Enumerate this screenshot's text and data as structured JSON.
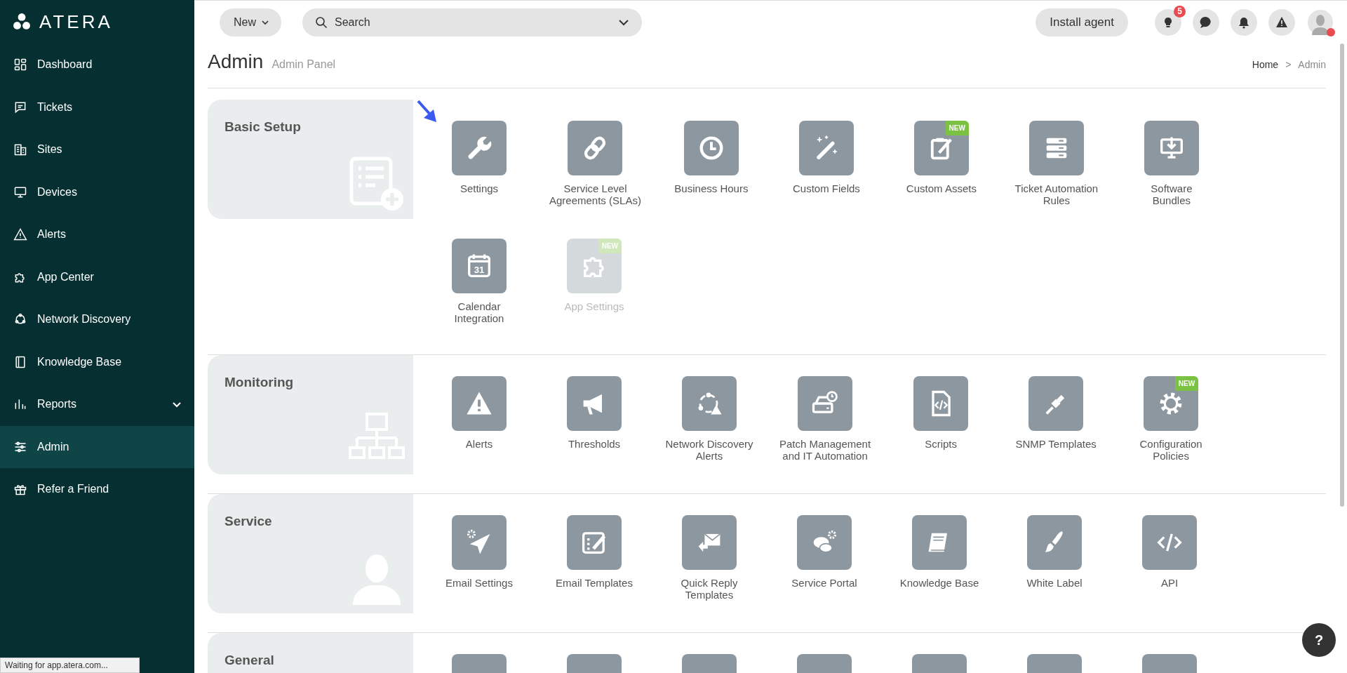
{
  "sidebar": {
    "logo": "ATERA",
    "items": [
      {
        "label": "Dashboard",
        "kind": "link",
        "selected": false
      },
      {
        "label": "Tickets",
        "kind": "link",
        "selected": false
      },
      {
        "label": "Sites",
        "kind": "link",
        "selected": false
      },
      {
        "label": "Devices",
        "kind": "link",
        "selected": false
      },
      {
        "label": "Alerts",
        "kind": "link",
        "selected": false
      },
      {
        "label": "App Center",
        "kind": "link",
        "selected": false
      },
      {
        "label": "Network Discovery",
        "kind": "link",
        "selected": false
      },
      {
        "label": "Knowledge Base",
        "kind": "link",
        "selected": false
      },
      {
        "label": "Reports",
        "kind": "group",
        "selected": false
      },
      {
        "label": "Admin",
        "kind": "link",
        "selected": true
      },
      {
        "label": "Refer a Friend",
        "kind": "link",
        "selected": false
      }
    ]
  },
  "topbar": {
    "new_button": "New",
    "search": {
      "placeholder": "Search"
    },
    "install_button": "Install agent",
    "notification_badge": "5"
  },
  "header": {
    "title": "Admin",
    "subtitle": "Admin Panel",
    "breadcrumb": {
      "items": [
        "Home",
        "Admin"
      ],
      "separator": ">"
    }
  },
  "sections": [
    {
      "title": "Basic Setup",
      "items": [
        {
          "label": "Settings",
          "disabled": false
        },
        {
          "label": "Service Level\nAgreements (SLAs)",
          "disabled": false
        },
        {
          "label": "Business Hours",
          "disabled": false
        },
        {
          "label": "Custom Fields",
          "disabled": false
        },
        {
          "label": "Custom Assets",
          "disabled": false,
          "badge": "NEW"
        },
        {
          "label": "Ticket Automation\nRules",
          "disabled": false
        },
        {
          "label": "Software\nBundles",
          "disabled": false
        },
        {
          "label": "Calendar\nIntegration",
          "disabled": false,
          "icon_text": "31"
        },
        {
          "label": "App Settings",
          "disabled": true,
          "badge": "NEW"
        }
      ]
    },
    {
      "title": "Monitoring",
      "items": [
        {
          "label": "Alerts",
          "disabled": false
        },
        {
          "label": "Thresholds",
          "disabled": false
        },
        {
          "label": "Network Discovery\nAlerts",
          "disabled": false
        },
        {
          "label": "Patch Management\nand IT Automation",
          "disabled": false
        },
        {
          "label": "Scripts",
          "disabled": false
        },
        {
          "label": "SNMP Templates",
          "disabled": false
        },
        {
          "label": "Configuration\nPolicies",
          "disabled": false,
          "badge": "NEW"
        }
      ]
    },
    {
      "title": "Service",
      "items": [
        {
          "label": "Email Settings",
          "disabled": false
        },
        {
          "label": "Email Templates",
          "disabled": false
        },
        {
          "label": "Quick Reply\nTemplates",
          "disabled": false
        },
        {
          "label": "Service Portal",
          "disabled": false
        },
        {
          "label": "Knowledge Base",
          "disabled": false
        },
        {
          "label": "White Label",
          "disabled": false
        },
        {
          "label": "API",
          "disabled": false
        }
      ]
    },
    {
      "title": "General",
      "items": [
        {
          "disabled": false
        },
        {
          "disabled": false
        },
        {
          "disabled": false
        },
        {
          "disabled": false
        },
        {
          "disabled": false
        },
        {
          "disabled": false
        },
        {
          "disabled": false
        }
      ]
    }
  ],
  "status_bar": "Waiting for app.atera.com...",
  "help_button": "?"
}
